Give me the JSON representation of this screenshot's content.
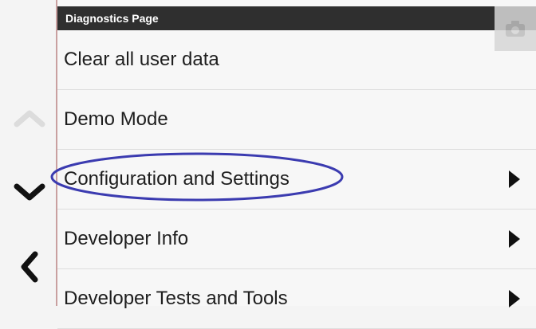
{
  "titlebar": {
    "title": "Diagnostics Page"
  },
  "nav": {
    "up_icon": "chevron-up-icon",
    "down_icon": "chevron-down-icon",
    "back_icon": "chevron-left-icon"
  },
  "menu": {
    "items": [
      {
        "label": "Clear all user data",
        "has_submenu": false
      },
      {
        "label": "Demo Mode",
        "has_submenu": false
      },
      {
        "label": "Configuration and Settings",
        "has_submenu": true
      },
      {
        "label": "Developer Info",
        "has_submenu": true
      },
      {
        "label": "Developer Tests and Tools",
        "has_submenu": true
      }
    ]
  },
  "annotation": {
    "highlight_color": "#3b3bb0",
    "highlighted_item": "Configuration and Settings"
  },
  "colors": {
    "titlebar_bg": "#2f2f2f",
    "divider": "#c9a0a0"
  }
}
